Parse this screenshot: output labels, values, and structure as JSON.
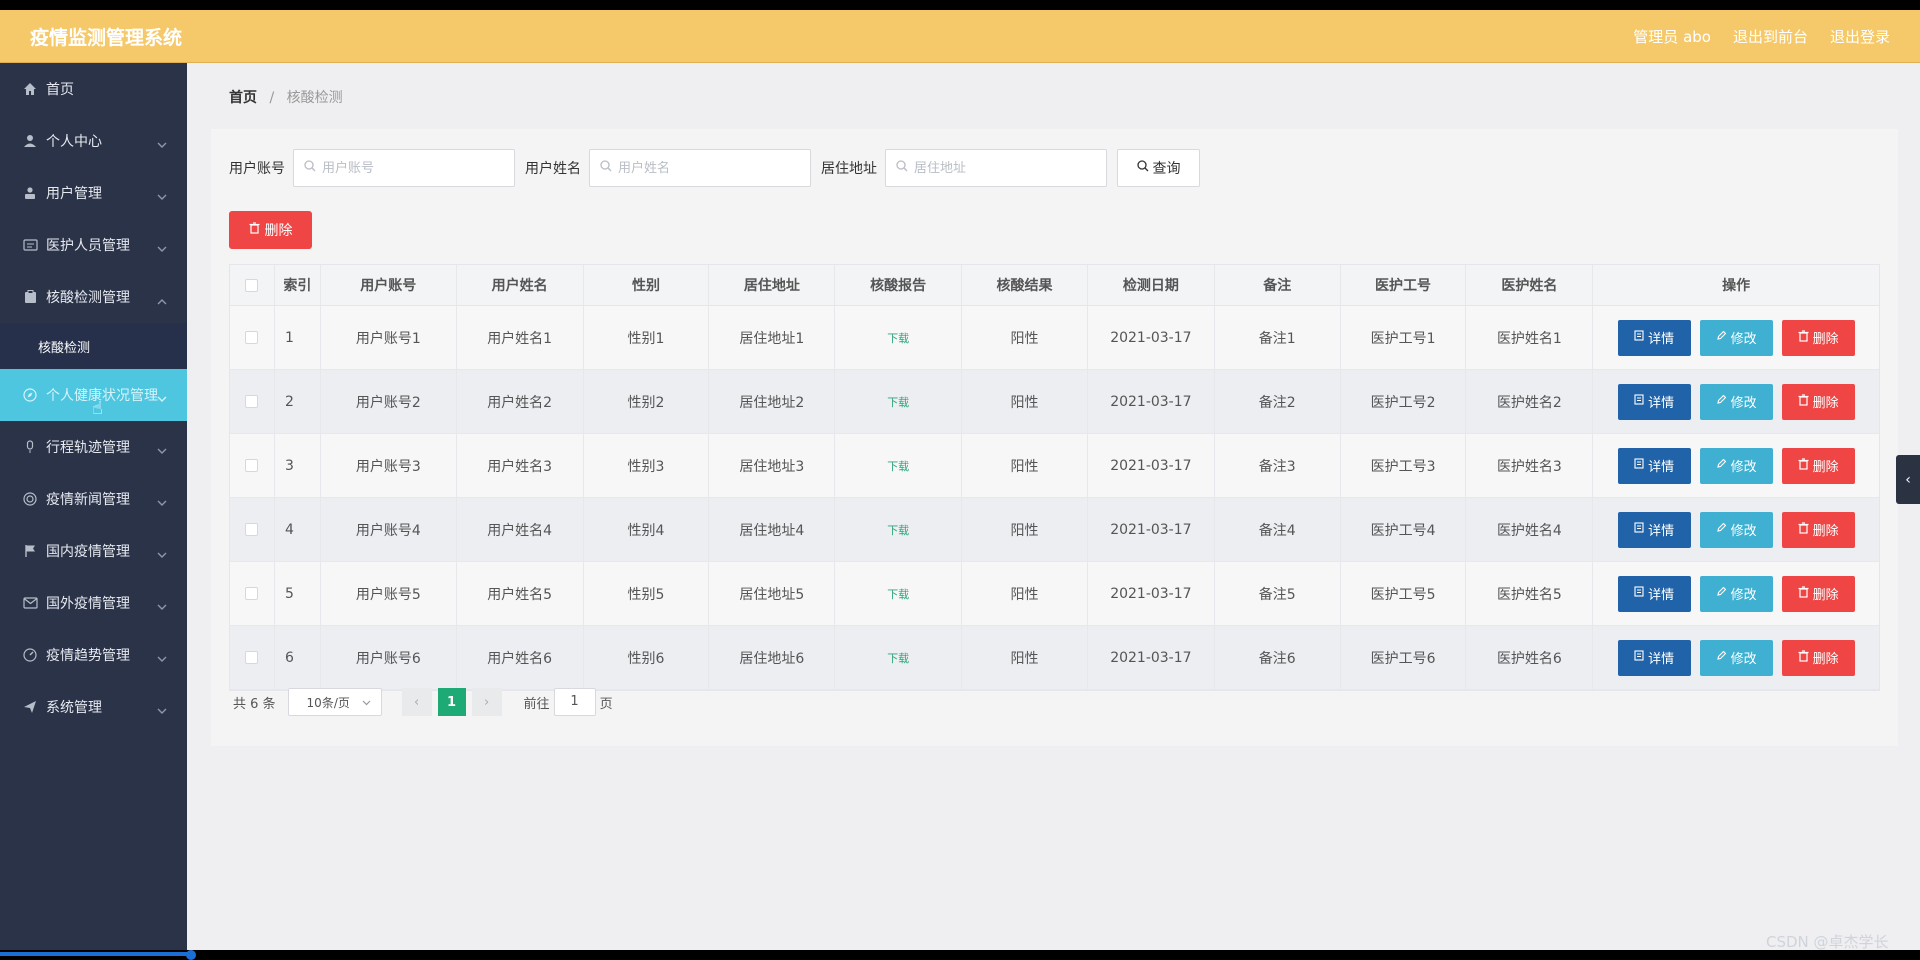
{
  "app": {
    "title": "疫情监测管理系统",
    "admin_label": "管理员 abo",
    "front_link": "退出到前台",
    "logout_link": "退出登录"
  },
  "sidebar": {
    "items": [
      {
        "label": "首页",
        "icon": "home-icon"
      },
      {
        "label": "个人中心",
        "icon": "user-icon"
      },
      {
        "label": "用户管理",
        "icon": "user-manage-icon"
      },
      {
        "label": "医护人员管理",
        "icon": "id-card-icon"
      },
      {
        "label": "核酸检测管理",
        "icon": "clipboard-icon"
      },
      {
        "label": "个人健康状况管理",
        "icon": "compass-icon"
      },
      {
        "label": "行程轨迹管理",
        "icon": "mic-icon"
      },
      {
        "label": "疫情新闻管理",
        "icon": "target-icon"
      },
      {
        "label": "国内疫情管理",
        "icon": "flag-icon"
      },
      {
        "label": "国外疫情管理",
        "icon": "mail-icon"
      },
      {
        "label": "疫情趋势管理",
        "icon": "gauge-icon"
      },
      {
        "label": "系统管理",
        "icon": "send-icon"
      }
    ],
    "submenu": [
      "核酸检测"
    ]
  },
  "breadcrumb": {
    "home": "首页",
    "current": "核酸检测"
  },
  "search": {
    "account_label": "用户账号",
    "account_placeholder": "用户账号",
    "name_label": "用户姓名",
    "name_placeholder": "用户姓名",
    "address_label": "居住地址",
    "address_placeholder": "居住地址",
    "query_label": "查询"
  },
  "toolbar": {
    "delete_label": "删除"
  },
  "table": {
    "headers": [
      "索引",
      "用户账号",
      "用户姓名",
      "性别",
      "居住地址",
      "核酸报告",
      "核酸结果",
      "检测日期",
      "备注",
      "医护工号",
      "医护姓名",
      "操作"
    ],
    "rows": [
      {
        "idx": "1",
        "account": "用户账号1",
        "name": "用户姓名1",
        "sex": "性别1",
        "addr": "居住地址1",
        "report": "下载",
        "result": "阳性",
        "date": "2021-03-17",
        "note": "备注1",
        "wid": "医护工号1",
        "wname": "医护姓名1"
      },
      {
        "idx": "2",
        "account": "用户账号2",
        "name": "用户姓名2",
        "sex": "性别2",
        "addr": "居住地址2",
        "report": "下载",
        "result": "阳性",
        "date": "2021-03-17",
        "note": "备注2",
        "wid": "医护工号2",
        "wname": "医护姓名2"
      },
      {
        "idx": "3",
        "account": "用户账号3",
        "name": "用户姓名3",
        "sex": "性别3",
        "addr": "居住地址3",
        "report": "下载",
        "result": "阳性",
        "date": "2021-03-17",
        "note": "备注3",
        "wid": "医护工号3",
        "wname": "医护姓名3"
      },
      {
        "idx": "4",
        "account": "用户账号4",
        "name": "用户姓名4",
        "sex": "性别4",
        "addr": "居住地址4",
        "report": "下载",
        "result": "阳性",
        "date": "2021-03-17",
        "note": "备注4",
        "wid": "医护工号4",
        "wname": "医护姓名4"
      },
      {
        "idx": "5",
        "account": "用户账号5",
        "name": "用户姓名5",
        "sex": "性别5",
        "addr": "居住地址5",
        "report": "下载",
        "result": "阳性",
        "date": "2021-03-17",
        "note": "备注5",
        "wid": "医护工号5",
        "wname": "医护姓名5"
      },
      {
        "idx": "6",
        "account": "用户账号6",
        "name": "用户姓名6",
        "sex": "性别6",
        "addr": "居住地址6",
        "report": "下载",
        "result": "阳性",
        "date": "2021-03-17",
        "note": "备注6",
        "wid": "医护工号6",
        "wname": "医护姓名6"
      }
    ],
    "ops": {
      "detail": "详情",
      "edit": "修改",
      "delete": "删除"
    }
  },
  "pagination": {
    "total": "共 6 条",
    "page_size": "10条/页",
    "current_page": "1",
    "goto_prefix": "前往",
    "goto_value": "1",
    "goto_suffix": "页"
  },
  "watermark": "CSDN @卓杰学长",
  "colors": {
    "topbar": "#f5c96a",
    "sidebar": "#2b3349",
    "active_menu": "#4ec6e0",
    "danger": "#f04545",
    "primary": "#2063a8",
    "info": "#3fb0d2",
    "success": "#1eaa74"
  }
}
